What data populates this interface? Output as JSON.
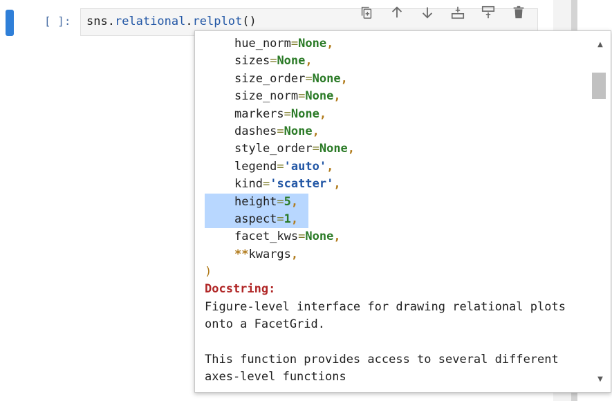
{
  "cell": {
    "prompt": "[ ]:",
    "code_prefix": "sns.",
    "code_attr1": "relational",
    "code_dot": ".",
    "code_attr2": "relplot",
    "code_suffix": "()"
  },
  "toolbar": {
    "buttons": [
      "duplicate-cell",
      "move-up",
      "move-down",
      "insert-below",
      "insert-above",
      "delete-cell"
    ]
  },
  "tooltip": {
    "params": [
      {
        "name": "hue_norm",
        "value": "None",
        "type": "none"
      },
      {
        "name": "sizes",
        "value": "None",
        "type": "none"
      },
      {
        "name": "size_order",
        "value": "None",
        "type": "none"
      },
      {
        "name": "size_norm",
        "value": "None",
        "type": "none"
      },
      {
        "name": "markers",
        "value": "None",
        "type": "none"
      },
      {
        "name": "dashes",
        "value": "None",
        "type": "none"
      },
      {
        "name": "style_order",
        "value": "None",
        "type": "none"
      },
      {
        "name": "legend",
        "value": "'auto'",
        "type": "str"
      },
      {
        "name": "kind",
        "value": "'scatter'",
        "type": "str"
      },
      {
        "name": "height",
        "value": "5",
        "type": "num"
      },
      {
        "name": "aspect",
        "value": "1",
        "type": "num"
      },
      {
        "name": "facet_kws",
        "value": "None",
        "type": "none"
      }
    ],
    "kwargs": "kwargs",
    "close_paren": ")",
    "docstring_label": "Docstring:",
    "doc_lines": [
      "Figure-level interface for drawing relational plots",
      "onto a FacetGrid.",
      "",
      "This function provides access to several different",
      "axes-level functions"
    ]
  }
}
